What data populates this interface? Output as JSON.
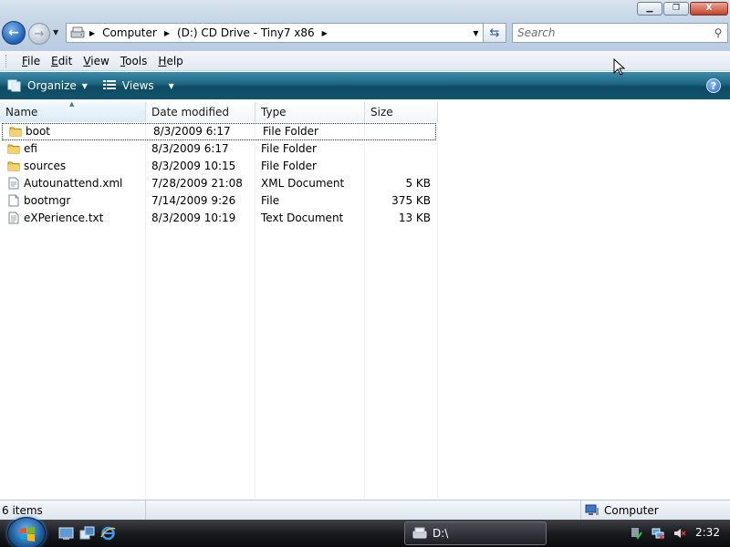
{
  "window": {
    "controls": {
      "minimize": "▁",
      "maximize": "❐",
      "close": "X"
    }
  },
  "navigation": {
    "back_icon": "back-arrow-icon",
    "forward_icon": "forward-arrow-icon"
  },
  "address": {
    "crumbs": [
      "Computer",
      "(D:) CD Drive - Tiny7 x86"
    ]
  },
  "search": {
    "placeholder": "Search"
  },
  "menu": {
    "items": [
      {
        "label": "File",
        "accel": "F",
        "rest": "ile"
      },
      {
        "label": "Edit",
        "accel": "E",
        "rest": "dit"
      },
      {
        "label": "View",
        "accel": "V",
        "rest": "iew"
      },
      {
        "label": "Tools",
        "accel": "T",
        "rest": "ools"
      },
      {
        "label": "Help",
        "accel": "H",
        "rest": "elp"
      }
    ]
  },
  "commands": {
    "organize": "Organize",
    "views": "Views",
    "help": "?"
  },
  "columns": {
    "name": "Name",
    "date": "Date modified",
    "type": "Type",
    "size": "Size"
  },
  "files": [
    {
      "name": "boot",
      "date": "8/3/2009 6:17",
      "type": "File Folder",
      "size": "",
      "icon": "folder-icon"
    },
    {
      "name": "efi",
      "date": "8/3/2009 6:17",
      "type": "File Folder",
      "size": "",
      "icon": "folder-icon"
    },
    {
      "name": "sources",
      "date": "8/3/2009 10:15",
      "type": "File Folder",
      "size": "",
      "icon": "folder-icon"
    },
    {
      "name": "Autounattend.xml",
      "date": "7/28/2009 21:08",
      "type": "XML Document",
      "size": "5 KB",
      "icon": "xml-file-icon"
    },
    {
      "name": "bootmgr",
      "date": "7/14/2009 9:26",
      "type": "File",
      "size": "375 KB",
      "icon": "file-icon"
    },
    {
      "name": "eXPerience.txt",
      "date": "8/3/2009 10:19",
      "type": "Text Document",
      "size": "13 KB",
      "icon": "text-file-icon"
    }
  ],
  "status": {
    "count": "6 items",
    "zone": "Computer"
  },
  "taskbar": {
    "task_label": "D:\\",
    "clock": "2:32"
  },
  "colors": {
    "command_bar": "#1d6480",
    "folder": "#e8c14a",
    "taskbar": "#1a1b1f"
  }
}
